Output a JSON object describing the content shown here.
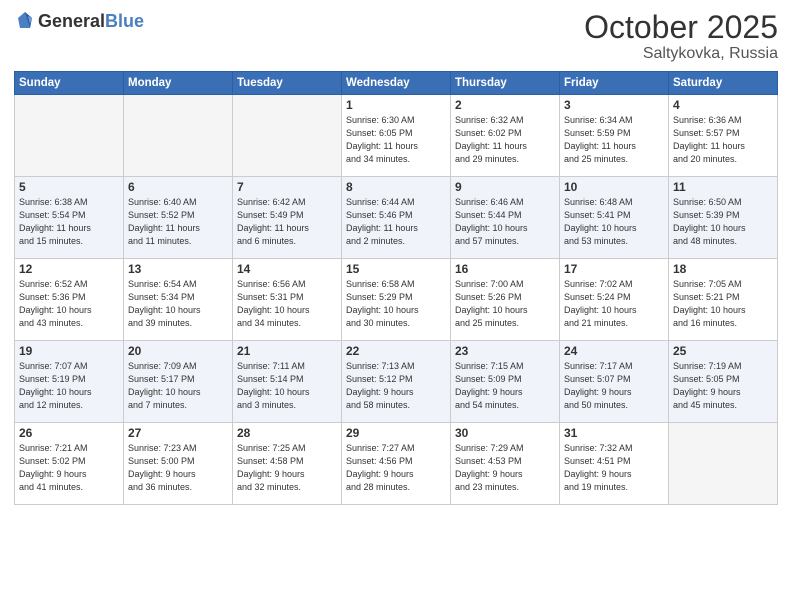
{
  "header": {
    "logo_general": "General",
    "logo_blue": "Blue",
    "month": "October 2025",
    "location": "Saltykovka, Russia"
  },
  "days_of_week": [
    "Sunday",
    "Monday",
    "Tuesday",
    "Wednesday",
    "Thursday",
    "Friday",
    "Saturday"
  ],
  "weeks": [
    [
      {
        "day": "",
        "info": ""
      },
      {
        "day": "",
        "info": ""
      },
      {
        "day": "",
        "info": ""
      },
      {
        "day": "1",
        "info": "Sunrise: 6:30 AM\nSunset: 6:05 PM\nDaylight: 11 hours\nand 34 minutes."
      },
      {
        "day": "2",
        "info": "Sunrise: 6:32 AM\nSunset: 6:02 PM\nDaylight: 11 hours\nand 29 minutes."
      },
      {
        "day": "3",
        "info": "Sunrise: 6:34 AM\nSunset: 5:59 PM\nDaylight: 11 hours\nand 25 minutes."
      },
      {
        "day": "4",
        "info": "Sunrise: 6:36 AM\nSunset: 5:57 PM\nDaylight: 11 hours\nand 20 minutes."
      }
    ],
    [
      {
        "day": "5",
        "info": "Sunrise: 6:38 AM\nSunset: 5:54 PM\nDaylight: 11 hours\nand 15 minutes."
      },
      {
        "day": "6",
        "info": "Sunrise: 6:40 AM\nSunset: 5:52 PM\nDaylight: 11 hours\nand 11 minutes."
      },
      {
        "day": "7",
        "info": "Sunrise: 6:42 AM\nSunset: 5:49 PM\nDaylight: 11 hours\nand 6 minutes."
      },
      {
        "day": "8",
        "info": "Sunrise: 6:44 AM\nSunset: 5:46 PM\nDaylight: 11 hours\nand 2 minutes."
      },
      {
        "day": "9",
        "info": "Sunrise: 6:46 AM\nSunset: 5:44 PM\nDaylight: 10 hours\nand 57 minutes."
      },
      {
        "day": "10",
        "info": "Sunrise: 6:48 AM\nSunset: 5:41 PM\nDaylight: 10 hours\nand 53 minutes."
      },
      {
        "day": "11",
        "info": "Sunrise: 6:50 AM\nSunset: 5:39 PM\nDaylight: 10 hours\nand 48 minutes."
      }
    ],
    [
      {
        "day": "12",
        "info": "Sunrise: 6:52 AM\nSunset: 5:36 PM\nDaylight: 10 hours\nand 43 minutes."
      },
      {
        "day": "13",
        "info": "Sunrise: 6:54 AM\nSunset: 5:34 PM\nDaylight: 10 hours\nand 39 minutes."
      },
      {
        "day": "14",
        "info": "Sunrise: 6:56 AM\nSunset: 5:31 PM\nDaylight: 10 hours\nand 34 minutes."
      },
      {
        "day": "15",
        "info": "Sunrise: 6:58 AM\nSunset: 5:29 PM\nDaylight: 10 hours\nand 30 minutes."
      },
      {
        "day": "16",
        "info": "Sunrise: 7:00 AM\nSunset: 5:26 PM\nDaylight: 10 hours\nand 25 minutes."
      },
      {
        "day": "17",
        "info": "Sunrise: 7:02 AM\nSunset: 5:24 PM\nDaylight: 10 hours\nand 21 minutes."
      },
      {
        "day": "18",
        "info": "Sunrise: 7:05 AM\nSunset: 5:21 PM\nDaylight: 10 hours\nand 16 minutes."
      }
    ],
    [
      {
        "day": "19",
        "info": "Sunrise: 7:07 AM\nSunset: 5:19 PM\nDaylight: 10 hours\nand 12 minutes."
      },
      {
        "day": "20",
        "info": "Sunrise: 7:09 AM\nSunset: 5:17 PM\nDaylight: 10 hours\nand 7 minutes."
      },
      {
        "day": "21",
        "info": "Sunrise: 7:11 AM\nSunset: 5:14 PM\nDaylight: 10 hours\nand 3 minutes."
      },
      {
        "day": "22",
        "info": "Sunrise: 7:13 AM\nSunset: 5:12 PM\nDaylight: 9 hours\nand 58 minutes."
      },
      {
        "day": "23",
        "info": "Sunrise: 7:15 AM\nSunset: 5:09 PM\nDaylight: 9 hours\nand 54 minutes."
      },
      {
        "day": "24",
        "info": "Sunrise: 7:17 AM\nSunset: 5:07 PM\nDaylight: 9 hours\nand 50 minutes."
      },
      {
        "day": "25",
        "info": "Sunrise: 7:19 AM\nSunset: 5:05 PM\nDaylight: 9 hours\nand 45 minutes."
      }
    ],
    [
      {
        "day": "26",
        "info": "Sunrise: 7:21 AM\nSunset: 5:02 PM\nDaylight: 9 hours\nand 41 minutes."
      },
      {
        "day": "27",
        "info": "Sunrise: 7:23 AM\nSunset: 5:00 PM\nDaylight: 9 hours\nand 36 minutes."
      },
      {
        "day": "28",
        "info": "Sunrise: 7:25 AM\nSunset: 4:58 PM\nDaylight: 9 hours\nand 32 minutes."
      },
      {
        "day": "29",
        "info": "Sunrise: 7:27 AM\nSunset: 4:56 PM\nDaylight: 9 hours\nand 28 minutes."
      },
      {
        "day": "30",
        "info": "Sunrise: 7:29 AM\nSunset: 4:53 PM\nDaylight: 9 hours\nand 23 minutes."
      },
      {
        "day": "31",
        "info": "Sunrise: 7:32 AM\nSunset: 4:51 PM\nDaylight: 9 hours\nand 19 minutes."
      },
      {
        "day": "",
        "info": ""
      }
    ]
  ]
}
